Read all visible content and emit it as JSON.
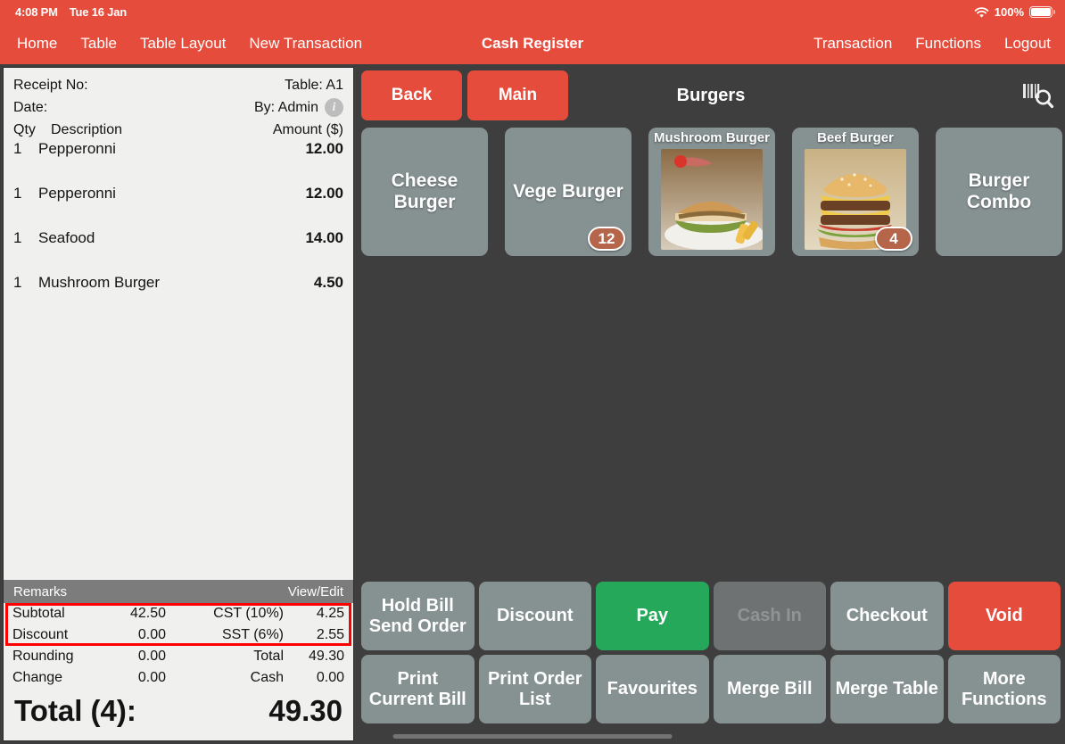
{
  "statusbar": {
    "time": "4:08 PM",
    "date": "Tue 16 Jan",
    "battery_percent": "100%",
    "wifi_icon": "wifi-icon",
    "battery_icon": "battery-icon"
  },
  "navbar": {
    "title": "Cash Register",
    "left_items": [
      {
        "label": "Home",
        "name": "nav-home"
      },
      {
        "label": "Table",
        "name": "nav-table"
      },
      {
        "label": "Table Layout",
        "name": "nav-table-layout"
      },
      {
        "label": "New Transaction",
        "name": "nav-new-transaction"
      }
    ],
    "right_items": [
      {
        "label": "Transaction",
        "name": "nav-transaction"
      },
      {
        "label": "Functions",
        "name": "nav-functions"
      },
      {
        "label": "Logout",
        "name": "nav-logout"
      }
    ]
  },
  "receipt": {
    "receipt_no_label": "Receipt No:",
    "receipt_no_value": "",
    "table_label": "Table: A1",
    "date_label": "Date:",
    "date_value": "",
    "by_label": "By: Admin",
    "info_icon": "info-icon",
    "columns": {
      "qty": "Qty",
      "description": "Description",
      "amount": "Amount ($)"
    },
    "items": [
      {
        "qty": "1",
        "description": "Pepperonni",
        "amount": "12.00"
      },
      {
        "qty": "1",
        "description": "Pepperonni",
        "amount": "12.00"
      },
      {
        "qty": "1",
        "description": "Seafood",
        "amount": "14.00"
      },
      {
        "qty": "1",
        "description": "Mushroom Burger",
        "amount": "4.50"
      }
    ],
    "remarks_label": "Remarks",
    "remarks_action": "View/Edit",
    "totals": [
      {
        "label_left": "Subtotal",
        "value_left": "42.50",
        "label_right": "CST (10%)",
        "value_right": "4.25"
      },
      {
        "label_left": "Discount",
        "value_left": "0.00",
        "label_right": "SST (6%)",
        "value_right": "2.55"
      },
      {
        "label_left": "Rounding",
        "value_left": "0.00",
        "label_right": "Total",
        "value_right": "49.30"
      },
      {
        "label_left": "Change",
        "value_left": "0.00",
        "label_right": "Cash",
        "value_right": "0.00"
      }
    ],
    "grand_total_label": "Total (4):",
    "grand_total_value": "49.30"
  },
  "toolbar": {
    "back_label": "Back",
    "main_label": "Main",
    "category_title": "Burgers",
    "scan_icon": "barcode-search-icon"
  },
  "products": [
    {
      "name": "Cheese Burger",
      "has_image": false,
      "badge": null
    },
    {
      "name": "Vege Burger",
      "has_image": false,
      "badge": "12"
    },
    {
      "name": "Mushroom Burger",
      "has_image": true,
      "badge": null
    },
    {
      "name": "Beef Burger",
      "has_image": true,
      "badge": "4"
    },
    {
      "name": "Burger Combo",
      "has_image": false,
      "badge": null
    }
  ],
  "actions_row1": [
    {
      "label": "Hold Bill\nSend Order",
      "name": "hold-bill-send-order-button",
      "style": "default",
      "disabled": false
    },
    {
      "label": "Discount",
      "name": "discount-button",
      "style": "default",
      "disabled": false
    },
    {
      "label": "Pay",
      "name": "pay-button",
      "style": "green",
      "disabled": false
    },
    {
      "label": "Cash In",
      "name": "cash-in-button",
      "style": "disabled",
      "disabled": true
    },
    {
      "label": "Checkout",
      "name": "checkout-button",
      "style": "default",
      "disabled": false
    },
    {
      "label": "Void",
      "name": "void-button",
      "style": "red",
      "disabled": false
    }
  ],
  "actions_row2": [
    {
      "label": "Print\nCurrent Bill",
      "name": "print-current-bill-button",
      "style": "default",
      "disabled": false
    },
    {
      "label": "Print Order\nList",
      "name": "print-order-list-button",
      "style": "default",
      "disabled": false
    },
    {
      "label": "Favourites",
      "name": "favourites-button",
      "style": "default",
      "disabled": false
    },
    {
      "label": "Merge Bill",
      "name": "merge-bill-button",
      "style": "default",
      "disabled": false
    },
    {
      "label": "Merge Table",
      "name": "merge-table-button",
      "style": "default",
      "disabled": false
    },
    {
      "label": "More\nFunctions",
      "name": "more-functions-button",
      "style": "default",
      "disabled": false
    }
  ],
  "colors": {
    "accent_red": "#e54c3c",
    "pay_green": "#25a85a",
    "tile_gray": "#869192",
    "background_dark": "#3e3e3e",
    "badge_brown": "#b4654a",
    "highlight_red": "#ff0000"
  }
}
